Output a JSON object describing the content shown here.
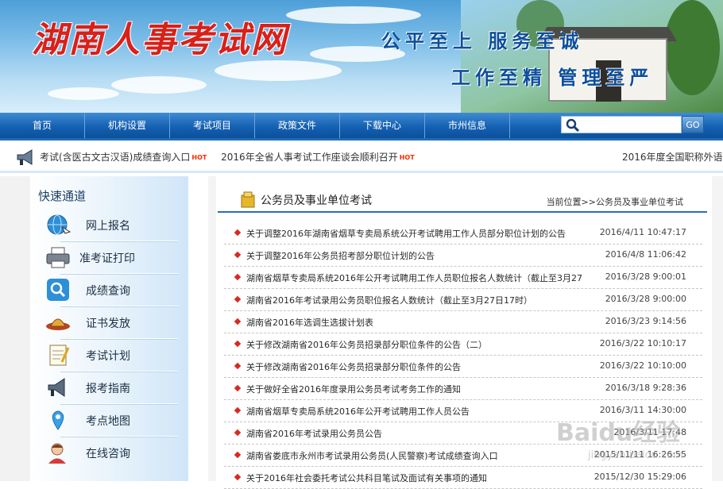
{
  "header": {
    "site_title": "湖南人事考试网",
    "slogan_1": "公平至上 服务至诚",
    "slogan_2": "工作至精 管理至严"
  },
  "nav": {
    "items": [
      "首页",
      "机构设置",
      "考试项目",
      "政策文件",
      "下载中心",
      "市州信息"
    ],
    "search_placeholder": "",
    "go_label": "GO"
  },
  "ticker": {
    "items": [
      "考试(含医古文古汉语)成绩查询入口",
      "2016年全省人事考试工作座谈会顺利召开"
    ],
    "hot_label": "HOT",
    "right_text": "2016年度全国职称外语"
  },
  "sidebar": {
    "title": "快速通道",
    "items": [
      {
        "label": "网上报名",
        "icon": "globe-icon"
      },
      {
        "label": "准考证打印",
        "icon": "printer-icon"
      },
      {
        "label": "成绩查询",
        "icon": "magnifier-icon"
      },
      {
        "label": "证书发放",
        "icon": "certificate-icon"
      },
      {
        "label": "考试计划",
        "icon": "notepad-icon"
      },
      {
        "label": "报考指南",
        "icon": "megaphone-icon"
      },
      {
        "label": "考点地图",
        "icon": "map-pin-icon"
      },
      {
        "label": "在线咨询",
        "icon": "consult-icon"
      }
    ]
  },
  "main": {
    "section_title": "公务员及事业单位考试",
    "breadcrumb": "当前位置>>公务员及事业单位考试",
    "articles": [
      {
        "title": "关于调整2016年湖南省烟草专卖局系统公开考试聘用工作人员部分职位计划的公告",
        "date": "2016/4/11 10:47:17"
      },
      {
        "title": "关于调整2016年公务员招考部分职位计划的公告",
        "date": "2016/4/8 11:06:42"
      },
      {
        "title": "湖南省烟草专卖局系统2016年公开考试聘用工作人员职位报名人数统计（截止至3月27",
        "date": "2016/3/28 9:00:01"
      },
      {
        "title": "湖南省2016年考试录用公务员职位报名人数统计（截止至3月27日17时）",
        "date": "2016/3/28 9:00:00"
      },
      {
        "title": "湖南省2016年选调生选拔计划表",
        "date": "2016/3/23 9:14:56"
      },
      {
        "title": "关于修改湖南省2016年公务员招录部分职位条件的公告（二）",
        "date": "2016/3/22 10:10:17"
      },
      {
        "title": "关于修改湖南省2016年公务员招录部分职位条件的公告",
        "date": "2016/3/22 10:10:00"
      },
      {
        "title": "关于做好全省2016年度录用公务员考试考务工作的通知",
        "date": "2016/3/18 9:28:36"
      },
      {
        "title": "湖南省烟草专卖局系统2016年公开考试聘用工作人员公告",
        "date": "2016/3/11 14:30:00"
      },
      {
        "title": "湖南省2016年考试录用公务员公告",
        "date": "2016/3/11 17:48"
      },
      {
        "title": "湖南省娄底市永州市考试录用公务员(人民警察)考试成绩查询入口",
        "date": "2015/11/11 16:26:55"
      },
      {
        "title": "关于2016年社会委托考试公共科目笔试及面试有关事项的通知",
        "date": "2015/12/30 15:29:06"
      }
    ]
  },
  "watermark": {
    "brand": "Baidu经验",
    "sub": "jingyan.baidu.com"
  }
}
